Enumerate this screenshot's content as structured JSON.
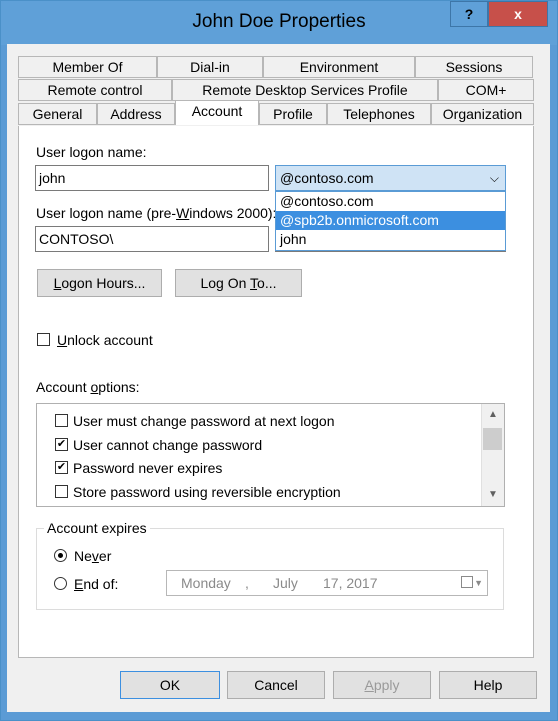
{
  "window": {
    "title": "John Doe Properties",
    "help_label": "?",
    "close_label": "x"
  },
  "tabs": {
    "row1": [
      "Member Of",
      "Dial-in",
      "Environment",
      "Sessions"
    ],
    "row2": [
      "Remote control",
      "Remote Desktop Services Profile",
      "COM+"
    ],
    "row3": [
      "General",
      "Address",
      "Account",
      "Profile",
      "Telephones",
      "Organization"
    ],
    "selected": "Account"
  },
  "account": {
    "logon_name_label": "User logon name:",
    "logon_name_value": "john",
    "domain_selected": "@contoso.com",
    "domain_options": [
      "@contoso.com",
      "@spb2b.onmicrosoft.com",
      "john"
    ],
    "pre2000_label_a": "User logon name (pre-",
    "pre2000_label_u": "W",
    "pre2000_label_b": "indows 2000):",
    "pre2000_domain": "CONTOSO\\",
    "logon_hours_u": "L",
    "logon_hours_rest": "ogon Hours...",
    "log_on_to_a": "Log On ",
    "log_on_to_u": "T",
    "log_on_to_b": "o...",
    "unlock_u": "U",
    "unlock_rest": "nlock account",
    "account_options_a": "Account ",
    "account_options_u": "o",
    "account_options_b": "ptions:",
    "options": [
      {
        "label": "User must change password at next logon",
        "checked": false
      },
      {
        "label": "User cannot change password",
        "checked": true
      },
      {
        "label": "Password never expires",
        "checked": true
      },
      {
        "label": "Store password using reversible encryption",
        "checked": false
      }
    ],
    "expires_label": "Account expires",
    "never_a": "Ne",
    "never_u": "v",
    "never_b": "er",
    "end_of_u": "E",
    "end_of_rest": "nd of:",
    "date_day": "Monday",
    "date_sep": ",",
    "date_month": "July",
    "date_rest": "17, 2017"
  },
  "footer": {
    "ok": "OK",
    "cancel": "Cancel",
    "apply_u": "A",
    "apply_rest": "pply",
    "help": "Help"
  }
}
